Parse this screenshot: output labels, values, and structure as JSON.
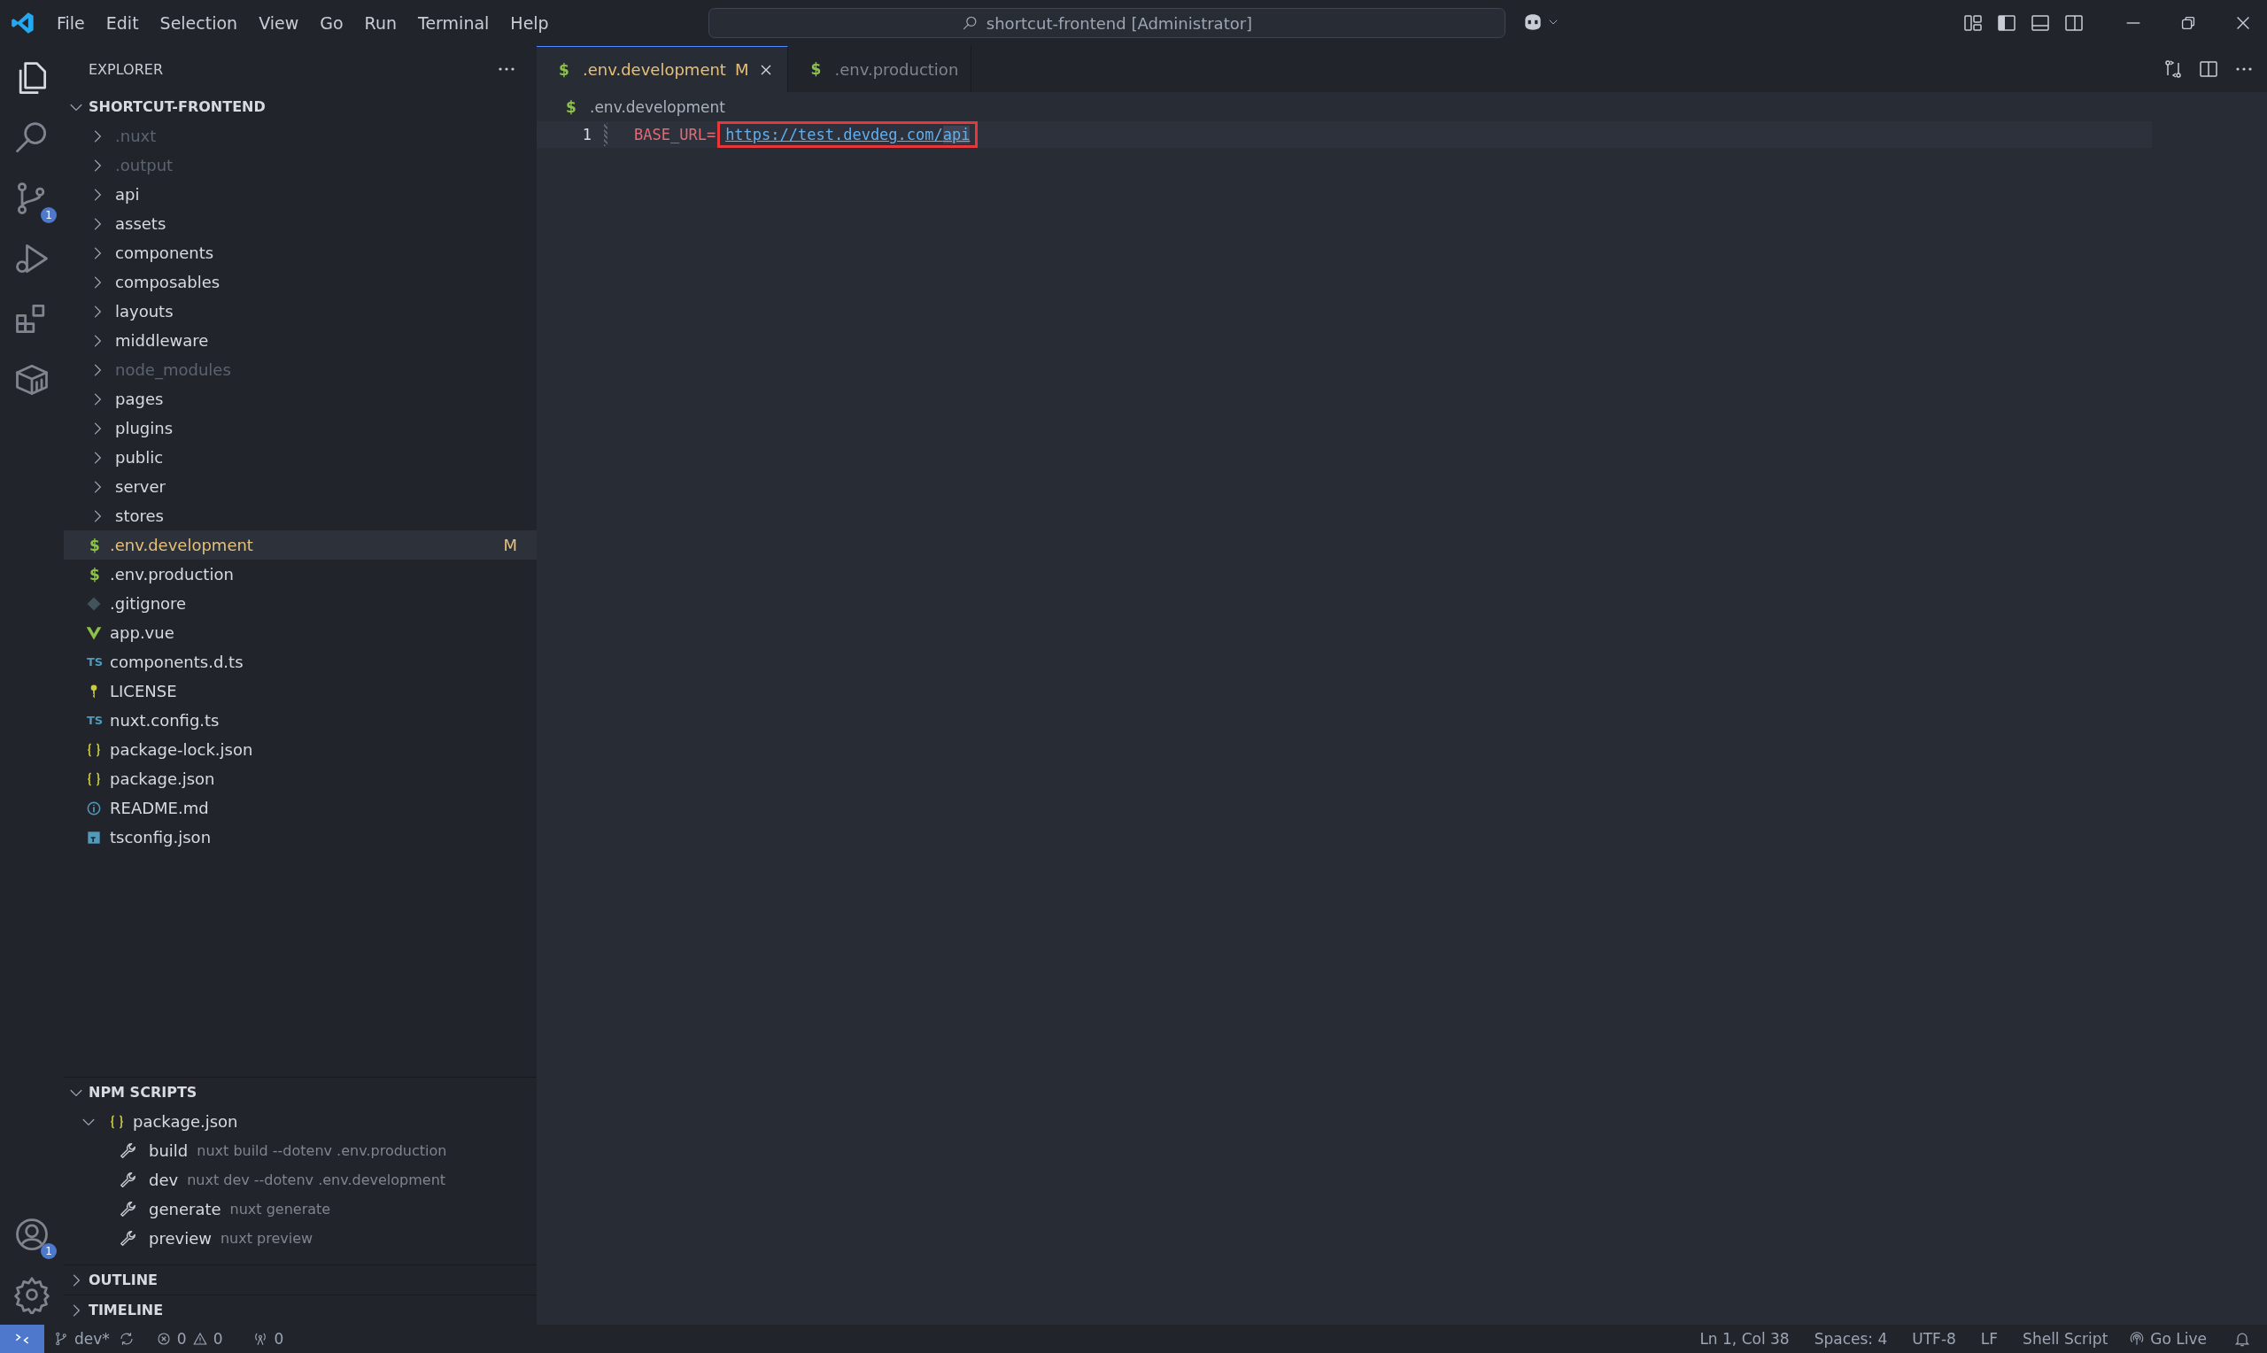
{
  "menu": [
    "File",
    "Edit",
    "Selection",
    "View",
    "Go",
    "Run",
    "Terminal",
    "Help"
  ],
  "command_center": {
    "value": "shortcut-frontend [Administrator]"
  },
  "activity_bar": {
    "source_control_badge": "1",
    "accounts_badge": "1"
  },
  "explorer": {
    "title": "EXPLORER",
    "root": {
      "label": "SHORTCUT-FRONTEND",
      "expanded": true,
      "children": [
        {
          "label": ".nuxt",
          "kind": "folder",
          "expanded": false,
          "ignored": true,
          "selected": false
        },
        {
          "label": ".output",
          "kind": "folder",
          "expanded": false,
          "ignored": true,
          "selected": false
        },
        {
          "label": "api",
          "kind": "folder",
          "expanded": false,
          "ignored": false,
          "selected": false
        },
        {
          "label": "assets",
          "kind": "folder",
          "expanded": false,
          "ignored": false,
          "selected": false
        },
        {
          "label": "components",
          "kind": "folder",
          "expanded": false,
          "ignored": false,
          "selected": false
        },
        {
          "label": "composables",
          "kind": "folder",
          "expanded": false,
          "ignored": false,
          "selected": false
        },
        {
          "label": "layouts",
          "kind": "folder",
          "expanded": false,
          "ignored": false,
          "selected": false
        },
        {
          "label": "middleware",
          "kind": "folder",
          "expanded": false,
          "ignored": false,
          "selected": false
        },
        {
          "label": "node_modules",
          "kind": "folder",
          "expanded": false,
          "ignored": true,
          "selected": false
        },
        {
          "label": "pages",
          "kind": "folder",
          "expanded": false,
          "ignored": false,
          "selected": false
        },
        {
          "label": "plugins",
          "kind": "folder",
          "expanded": false,
          "ignored": false,
          "selected": false
        },
        {
          "label": "public",
          "kind": "folder",
          "expanded": false,
          "ignored": false,
          "selected": false
        },
        {
          "label": "server",
          "kind": "folder",
          "expanded": false,
          "ignored": false,
          "selected": false
        },
        {
          "label": "stores",
          "kind": "folder",
          "expanded": false,
          "ignored": false,
          "selected": false
        },
        {
          "label": ".env.development",
          "kind": "env",
          "icon": "$",
          "status": "M",
          "ignored": false,
          "selected": true
        },
        {
          "label": ".env.production",
          "kind": "env",
          "icon": "$",
          "ignored": false,
          "selected": false
        },
        {
          "label": ".gitignore",
          "kind": "git",
          "ignored": false,
          "selected": false
        },
        {
          "label": "app.vue",
          "kind": "vue",
          "ignored": false,
          "selected": false
        },
        {
          "label": "components.d.ts",
          "kind": "ts",
          "icon": "TS",
          "ignored": false,
          "selected": false
        },
        {
          "label": "LICENSE",
          "kind": "license",
          "ignored": false,
          "selected": false
        },
        {
          "label": "nuxt.config.ts",
          "kind": "ts",
          "icon": "TS",
          "ignored": false,
          "selected": false
        },
        {
          "label": "package-lock.json",
          "kind": "json",
          "ignored": false,
          "selected": false
        },
        {
          "label": "package.json",
          "kind": "json",
          "ignored": false,
          "selected": false
        },
        {
          "label": "README.md",
          "kind": "info",
          "ignored": false,
          "selected": false
        },
        {
          "label": "tsconfig.json",
          "kind": "tsconfig",
          "ignored": false,
          "selected": false
        }
      ]
    }
  },
  "npm_scripts": {
    "title": "NPM SCRIPTS",
    "expanded": true,
    "package": {
      "label": "package.json",
      "expanded": true,
      "scripts": [
        {
          "name": "build",
          "command": "nuxt build --dotenv .env.production"
        },
        {
          "name": "dev",
          "command": "nuxt dev --dotenv .env.development"
        },
        {
          "name": "generate",
          "command": "nuxt generate"
        },
        {
          "name": "preview",
          "command": "nuxt preview"
        }
      ]
    }
  },
  "panels": [
    {
      "title": "OUTLINE",
      "expanded": false
    },
    {
      "title": "TIMELINE",
      "expanded": false
    }
  ],
  "tabs": [
    {
      "icon": "$",
      "label": ".env.development",
      "status": "M",
      "selected": true
    },
    {
      "icon": "$",
      "label": ".env.production",
      "selected": false
    }
  ],
  "breadcrumb": {
    "icon": "$",
    "label": ".env.development"
  },
  "editor": {
    "lines": [
      {
        "number": "1",
        "key": "BASE_URL=",
        "value": "https://test.devdeg.com/",
        "selected_text": "api"
      }
    ]
  },
  "status_bar": {
    "branch": "dev*",
    "errors": "0",
    "warnings": "0",
    "ports": "0",
    "items": [
      "Ln 1, Col 38",
      "Spaces: 4",
      "UTF-8",
      "LF",
      "Shell Script"
    ],
    "go_live": "Go Live"
  }
}
